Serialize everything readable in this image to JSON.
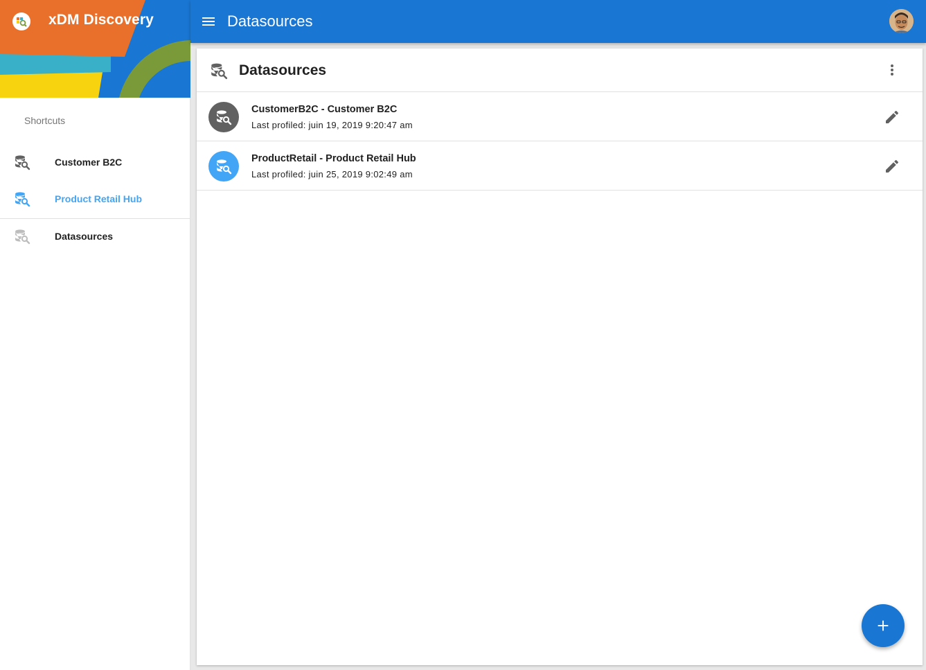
{
  "app": {
    "name": "xDM Discovery",
    "logo_icon": "xdm-discovery-logo-icon"
  },
  "sidebar": {
    "section_label": "Shortcuts",
    "items": [
      {
        "label": "Customer B2C",
        "icon": "datasource-search-icon",
        "active": false
      },
      {
        "label": "Product Retail Hub",
        "icon": "datasource-search-icon",
        "active": true
      },
      {
        "label": "Datasources",
        "icon": "datasource-search-icon",
        "active": false
      }
    ]
  },
  "topbar": {
    "title": "Datasources",
    "menu_icon": "hamburger-menu-icon",
    "avatar": "user-avatar"
  },
  "panel": {
    "title": "Datasources",
    "icon": "datasource-search-icon",
    "more_icon": "more-vertical-icon",
    "rows": [
      {
        "title": "CustomerB2C - Customer B2C",
        "subtitle": "Last profiled: juin 19, 2019 9:20:47 am",
        "avatar_color": "#616161",
        "action_icon": "edit-pencil-icon"
      },
      {
        "title": "ProductRetail - Product Retail Hub",
        "subtitle": "Last profiled: juin 25, 2019 9:02:49 am",
        "avatar_color": "#42a5f5",
        "action_icon": "edit-pencil-icon"
      }
    ]
  },
  "fab": {
    "icon": "plus-icon"
  },
  "colors": {
    "primary": "#1976d2",
    "active_nav": "#42a5f5",
    "header_orange": "#e8702a",
    "header_teal": "#3ab0c8",
    "header_yellow": "#f6d20f",
    "header_green": "#7a9a3a"
  }
}
